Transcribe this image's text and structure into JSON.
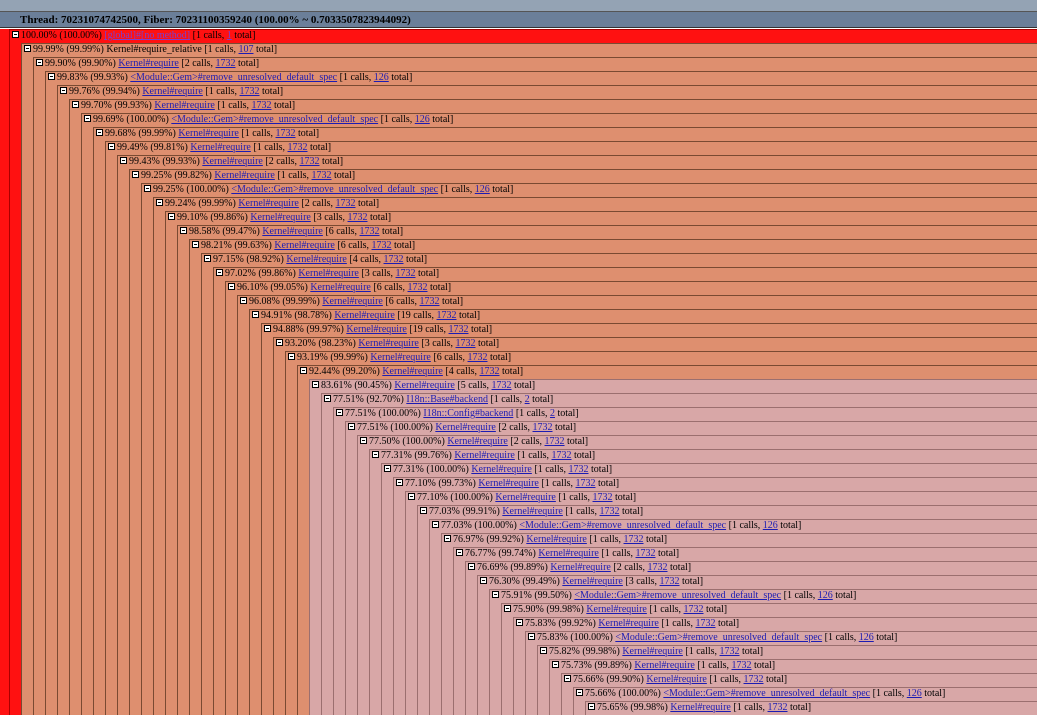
{
  "header": {
    "thread_label": "Thread: 70231074742500, Fiber: 70231100359240 (100.00% ~ 0.7033507823944092)"
  },
  "rows": [
    {
      "pct": "100.00% (100.00%)",
      "method": "[global]#[no method]",
      "calls": "[1 calls,",
      "total": "1",
      "suffix": "total]",
      "link": true,
      "style": "root"
    },
    {
      "pct": "99.99% (99.99%)",
      "method": "Kernel#require_relative",
      "calls": "[1 calls,",
      "total": "107",
      "suffix": "total]",
      "link": false,
      "style": "normal"
    },
    {
      "pct": "99.90% (99.90%)",
      "method": "Kernel#require",
      "calls": "[2 calls,",
      "total": "1732",
      "suffix": "total]",
      "link": true,
      "style": "normal"
    },
    {
      "pct": "99.83% (99.93%)",
      "method": "<Module::Gem>#remove_unresolved_default_spec",
      "calls": "[1 calls,",
      "total": "126",
      "suffix": "total]",
      "link": true,
      "style": "normal"
    },
    {
      "pct": "99.76% (99.94%)",
      "method": "Kernel#require",
      "calls": "[1 calls,",
      "total": "1732",
      "suffix": "total]",
      "link": true,
      "style": "normal"
    },
    {
      "pct": "99.70% (99.93%)",
      "method": "Kernel#require",
      "calls": "[1 calls,",
      "total": "1732",
      "suffix": "total]",
      "link": true,
      "style": "normal"
    },
    {
      "pct": "99.69% (100.00%)",
      "method": "<Module::Gem>#remove_unresolved_default_spec",
      "calls": "[1 calls,",
      "total": "126",
      "suffix": "total]",
      "link": true,
      "style": "normal"
    },
    {
      "pct": "99.68% (99.99%)",
      "method": "Kernel#require",
      "calls": "[1 calls,",
      "total": "1732",
      "suffix": "total]",
      "link": true,
      "style": "normal"
    },
    {
      "pct": "99.49% (99.81%)",
      "method": "Kernel#require",
      "calls": "[1 calls,",
      "total": "1732",
      "suffix": "total]",
      "link": true,
      "style": "normal"
    },
    {
      "pct": "99.43% (99.93%)",
      "method": "Kernel#require",
      "calls": "[2 calls,",
      "total": "1732",
      "suffix": "total]",
      "link": true,
      "style": "normal"
    },
    {
      "pct": "99.25% (99.82%)",
      "method": "Kernel#require",
      "calls": "[1 calls,",
      "total": "1732",
      "suffix": "total]",
      "link": true,
      "style": "normal"
    },
    {
      "pct": "99.25% (100.00%)",
      "method": "<Module::Gem>#remove_unresolved_default_spec",
      "calls": "[1 calls,",
      "total": "126",
      "suffix": "total]",
      "link": true,
      "style": "normal"
    },
    {
      "pct": "99.24% (99.99%)",
      "method": "Kernel#require",
      "calls": "[2 calls,",
      "total": "1732",
      "suffix": "total]",
      "link": true,
      "style": "normal"
    },
    {
      "pct": "99.10% (99.86%)",
      "method": "Kernel#require",
      "calls": "[3 calls,",
      "total": "1732",
      "suffix": "total]",
      "link": true,
      "style": "normal"
    },
    {
      "pct": "98.58% (99.47%)",
      "method": "Kernel#require",
      "calls": "[6 calls,",
      "total": "1732",
      "suffix": "total]",
      "link": true,
      "style": "normal"
    },
    {
      "pct": "98.21% (99.63%)",
      "method": "Kernel#require",
      "calls": "[6 calls,",
      "total": "1732",
      "suffix": "total]",
      "link": true,
      "style": "normal"
    },
    {
      "pct": "97.15% (98.92%)",
      "method": "Kernel#require",
      "calls": "[4 calls,",
      "total": "1732",
      "suffix": "total]",
      "link": true,
      "style": "normal"
    },
    {
      "pct": "97.02% (99.86%)",
      "method": "Kernel#require",
      "calls": "[3 calls,",
      "total": "1732",
      "suffix": "total]",
      "link": true,
      "style": "normal"
    },
    {
      "pct": "96.10% (99.05%)",
      "method": "Kernel#require",
      "calls": "[6 calls,",
      "total": "1732",
      "suffix": "total]",
      "link": true,
      "style": "normal"
    },
    {
      "pct": "96.08% (99.99%)",
      "method": "Kernel#require",
      "calls": "[6 calls,",
      "total": "1732",
      "suffix": "total]",
      "link": true,
      "style": "normal"
    },
    {
      "pct": "94.91% (98.78%)",
      "method": "Kernel#require",
      "calls": "[19 calls,",
      "total": "1732",
      "suffix": "total]",
      "link": true,
      "style": "normal"
    },
    {
      "pct": "94.88% (99.97%)",
      "method": "Kernel#require",
      "calls": "[19 calls,",
      "total": "1732",
      "suffix": "total]",
      "link": true,
      "style": "normal"
    },
    {
      "pct": "93.20% (98.23%)",
      "method": "Kernel#require",
      "calls": "[3 calls,",
      "total": "1732",
      "suffix": "total]",
      "link": true,
      "style": "normal"
    },
    {
      "pct": "93.19% (99.99%)",
      "method": "Kernel#require",
      "calls": "[6 calls,",
      "total": "1732",
      "suffix": "total]",
      "link": true,
      "style": "normal"
    },
    {
      "pct": "92.44% (99.20%)",
      "method": "Kernel#require",
      "calls": "[4 calls,",
      "total": "1732",
      "suffix": "total]",
      "link": true,
      "style": "normal"
    },
    {
      "pct": "83.61% (90.45%)",
      "method": "Kernel#require",
      "calls": "[5 calls,",
      "total": "1732",
      "suffix": "total]",
      "link": true,
      "style": "pale"
    },
    {
      "pct": "77.51% (92.70%)",
      "method": "I18n::Base#backend",
      "calls": "[1 calls,",
      "total": "2",
      "suffix": "total]",
      "link": true,
      "style": "pale"
    },
    {
      "pct": "77.51% (100.00%)",
      "method": "I18n::Config#backend",
      "calls": "[1 calls,",
      "total": "2",
      "suffix": "total]",
      "link": true,
      "style": "pale"
    },
    {
      "pct": "77.51% (100.00%)",
      "method": "Kernel#require",
      "calls": "[2 calls,",
      "total": "1732",
      "suffix": "total]",
      "link": true,
      "style": "pale"
    },
    {
      "pct": "77.50% (100.00%)",
      "method": "Kernel#require",
      "calls": "[2 calls,",
      "total": "1732",
      "suffix": "total]",
      "link": true,
      "style": "pale"
    },
    {
      "pct": "77.31% (99.76%)",
      "method": "Kernel#require",
      "calls": "[1 calls,",
      "total": "1732",
      "suffix": "total]",
      "link": true,
      "style": "pale"
    },
    {
      "pct": "77.31% (100.00%)",
      "method": "Kernel#require",
      "calls": "[1 calls,",
      "total": "1732",
      "suffix": "total]",
      "link": true,
      "style": "pale"
    },
    {
      "pct": "77.10% (99.73%)",
      "method": "Kernel#require",
      "calls": "[1 calls,",
      "total": "1732",
      "suffix": "total]",
      "link": true,
      "style": "pale"
    },
    {
      "pct": "77.10% (100.00%)",
      "method": "Kernel#require",
      "calls": "[1 calls,",
      "total": "1732",
      "suffix": "total]",
      "link": true,
      "style": "pale"
    },
    {
      "pct": "77.03% (99.91%)",
      "method": "Kernel#require",
      "calls": "[1 calls,",
      "total": "1732",
      "suffix": "total]",
      "link": true,
      "style": "pale"
    },
    {
      "pct": "77.03% (100.00%)",
      "method": "<Module::Gem>#remove_unresolved_default_spec",
      "calls": "[1 calls,",
      "total": "126",
      "suffix": "total]",
      "link": true,
      "style": "pale"
    },
    {
      "pct": "76.97% (99.92%)",
      "method": "Kernel#require",
      "calls": "[1 calls,",
      "total": "1732",
      "suffix": "total]",
      "link": true,
      "style": "pale"
    },
    {
      "pct": "76.77% (99.74%)",
      "method": "Kernel#require",
      "calls": "[1 calls,",
      "total": "1732",
      "suffix": "total]",
      "link": true,
      "style": "pale"
    },
    {
      "pct": "76.69% (99.89%)",
      "method": "Kernel#require",
      "calls": "[2 calls,",
      "total": "1732",
      "suffix": "total]",
      "link": true,
      "style": "pale"
    },
    {
      "pct": "76.30% (99.49%)",
      "method": "Kernel#require",
      "calls": "[3 calls,",
      "total": "1732",
      "suffix": "total]",
      "link": true,
      "style": "pale"
    },
    {
      "pct": "75.91% (99.50%)",
      "method": "<Module::Gem>#remove_unresolved_default_spec",
      "calls": "[1 calls,",
      "total": "126",
      "suffix": "total]",
      "link": true,
      "style": "pale"
    },
    {
      "pct": "75.90% (99.98%)",
      "method": "Kernel#require",
      "calls": "[1 calls,",
      "total": "1732",
      "suffix": "total]",
      "link": true,
      "style": "pale"
    },
    {
      "pct": "75.83% (99.92%)",
      "method": "Kernel#require",
      "calls": "[1 calls,",
      "total": "1732",
      "suffix": "total]",
      "link": true,
      "style": "pale"
    },
    {
      "pct": "75.83% (100.00%)",
      "method": "<Module::Gem>#remove_unresolved_default_spec",
      "calls": "[1 calls,",
      "total": "126",
      "suffix": "total]",
      "link": true,
      "style": "pale"
    },
    {
      "pct": "75.82% (99.98%)",
      "method": "Kernel#require",
      "calls": "[1 calls,",
      "total": "1732",
      "suffix": "total]",
      "link": true,
      "style": "pale"
    },
    {
      "pct": "75.73% (99.89%)",
      "method": "Kernel#require",
      "calls": "[1 calls,",
      "total": "1732",
      "suffix": "total]",
      "link": true,
      "style": "pale"
    },
    {
      "pct": "75.66% (99.90%)",
      "method": "Kernel#require",
      "calls": "[1 calls,",
      "total": "1732",
      "suffix": "total]",
      "link": true,
      "style": "pale"
    },
    {
      "pct": "75.66% (100.00%)",
      "method": "<Module::Gem>#remove_unresolved_default_spec",
      "calls": "[1 calls,",
      "total": "126",
      "suffix": "total]",
      "link": true,
      "style": "pale"
    },
    {
      "pct": "75.65% (99.98%)",
      "method": "Kernel#require",
      "calls": "[1 calls,",
      "total": "1732",
      "suffix": "total]",
      "link": true,
      "style": "pale"
    }
  ]
}
